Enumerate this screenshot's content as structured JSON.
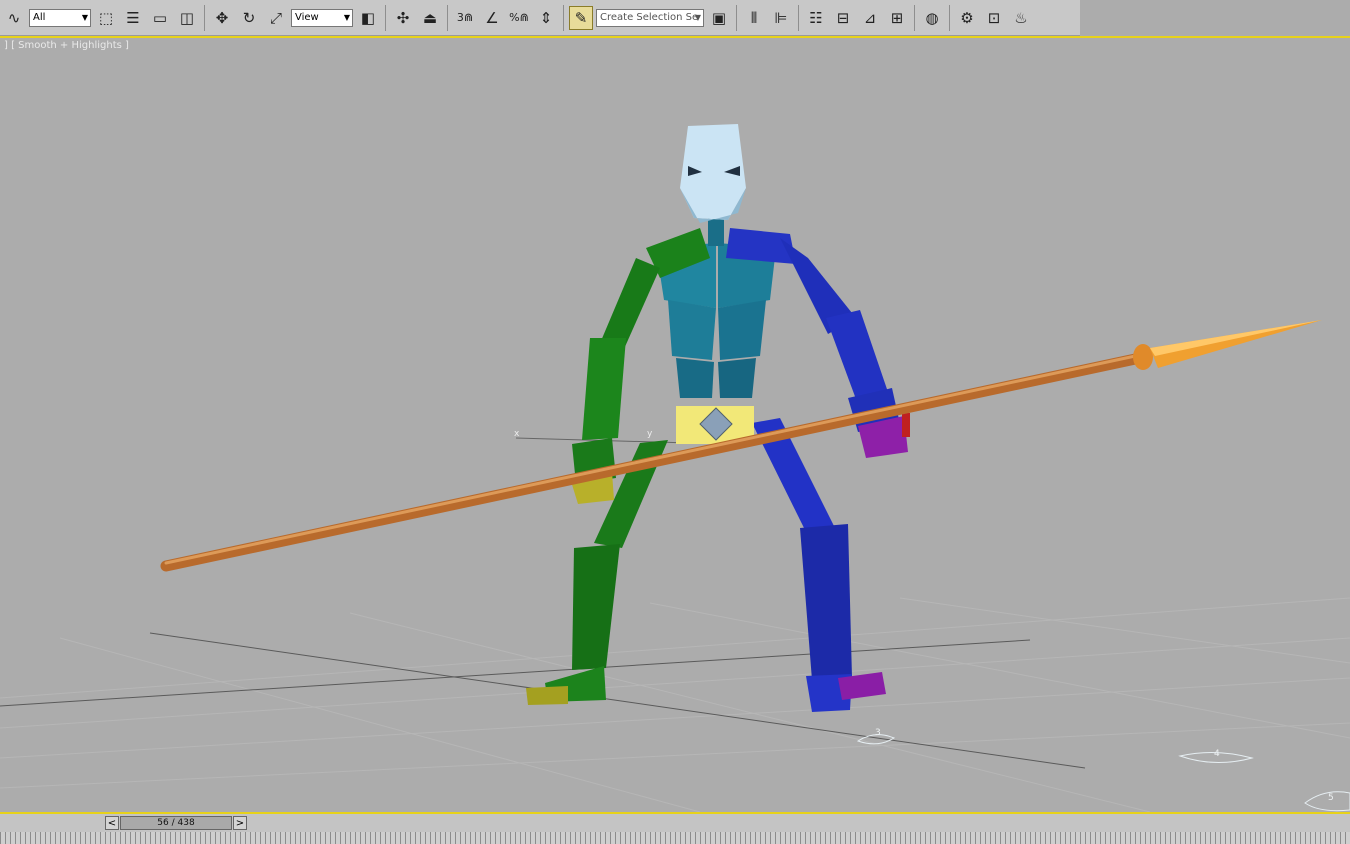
{
  "toolbar": {
    "selection_filter": "All",
    "reference_coord": "View",
    "named_selection_placeholder": "Create Selection Se",
    "snap_label": "3",
    "angle_snap_label": "",
    "percent_snap_label": "%"
  },
  "viewport": {
    "label": "] [ Smooth + Highlights ]",
    "axis_x": "x",
    "axis_y": "y",
    "footstep_3": "3",
    "footstep_4": "4",
    "footstep_5": "5"
  },
  "timeline": {
    "prev": "<",
    "next": ">",
    "frame": "56 / 438"
  },
  "colors": {
    "toolbar": "#c8c8c8",
    "viewport_bg": "#acacac",
    "active_border": "#e7d21a",
    "left_limbs": "#1b7d1b",
    "right_limbs": "#2030c0",
    "torso": "#1d7f9a",
    "head": "#c9e3f2",
    "pelvis": "#f4ea7a",
    "spear": "#c67a3a"
  }
}
